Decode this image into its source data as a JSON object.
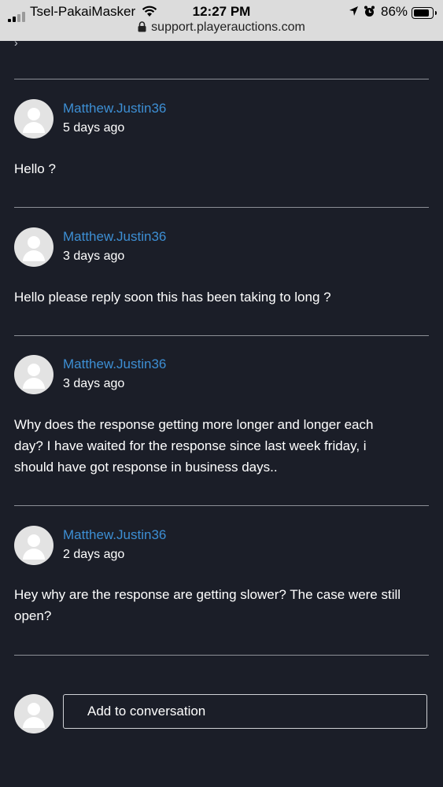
{
  "statusbar": {
    "carrier": "Tsel-PakaiMasker",
    "time": "12:27 PM",
    "battery": "86%",
    "battery_level": 0.86,
    "url": "support.playerauctions.com"
  },
  "messages": [
    {
      "author": "Matthew.Justin36",
      "when": "5 days ago",
      "text": "Hello ?"
    },
    {
      "author": "Matthew.Justin36",
      "when": "3 days ago",
      "text": "Hello please reply soon this has been taking to long ?"
    },
    {
      "author": "Matthew.Justin36",
      "when": "3 days ago",
      "text": "Why does the response getting more longer and longer each day? I have waited for the response since last week friday, i should have got response in business days.."
    },
    {
      "author": "Matthew.Justin36",
      "when": "2 days ago",
      "text": "Hey why are the response are getting slower? The case were still open?"
    }
  ],
  "compose": {
    "placeholder": "Add to conversation"
  },
  "colors": {
    "background": "#1b1e28",
    "author": "#3d8fd4",
    "statusbar": "#dcdcdc"
  }
}
